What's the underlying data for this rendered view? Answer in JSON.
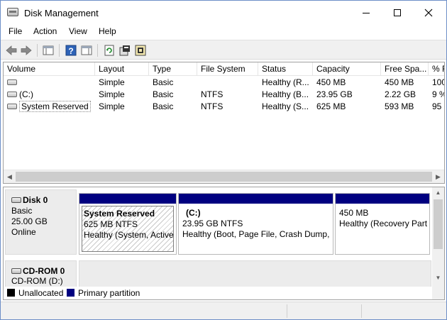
{
  "window": {
    "title": "Disk Management"
  },
  "menu": [
    "File",
    "Action",
    "View",
    "Help"
  ],
  "toolbar": {
    "icons": [
      "back-arrow-icon",
      "forward-arrow-icon",
      "show-hide-console-tree-icon",
      "help-icon",
      "show-hide-action-pane-icon",
      "refresh-icon",
      "properties-icon",
      "rescan-disks-icon"
    ]
  },
  "table": {
    "columns": [
      "Volume",
      "Layout",
      "Type",
      "File System",
      "Status",
      "Capacity",
      "Free Spa...",
      "% F"
    ],
    "rows": [
      {
        "volume": "",
        "layout": "Simple",
        "type": "Basic",
        "fs": "",
        "status": "Healthy (R...",
        "capacity": "450 MB",
        "free": "450 MB",
        "pct": "100"
      },
      {
        "volume": "(C:)",
        "layout": "Simple",
        "type": "Basic",
        "fs": "NTFS",
        "status": "Healthy (B...",
        "capacity": "23.95 GB",
        "free": "2.22 GB",
        "pct": "9 %"
      },
      {
        "volume": "System Reserved",
        "layout": "Simple",
        "type": "Basic",
        "fs": "NTFS",
        "status": "Healthy (S...",
        "capacity": "625 MB",
        "free": "593 MB",
        "pct": "95"
      }
    ]
  },
  "disk0": {
    "name": "Disk 0",
    "type": "Basic",
    "size": "25.00 GB",
    "state": "Online",
    "partitions": [
      {
        "title": "System Reserved",
        "size": "625 MB NTFS",
        "status": "Healthy (System, Active"
      },
      {
        "title": "(C:)",
        "size": "23.95 GB NTFS",
        "status": "Healthy (Boot, Page File, Crash Dump,"
      },
      {
        "title": "",
        "size": "450 MB",
        "status": "Healthy (Recovery Part"
      }
    ]
  },
  "cdrom0": {
    "name": "CD-ROM 0",
    "sub": "CD-ROM (D:)"
  },
  "legend": {
    "unallocated": "Unallocated",
    "primary": "Primary partition",
    "colors": {
      "unallocated": "#000000",
      "primary": "#000080"
    }
  }
}
